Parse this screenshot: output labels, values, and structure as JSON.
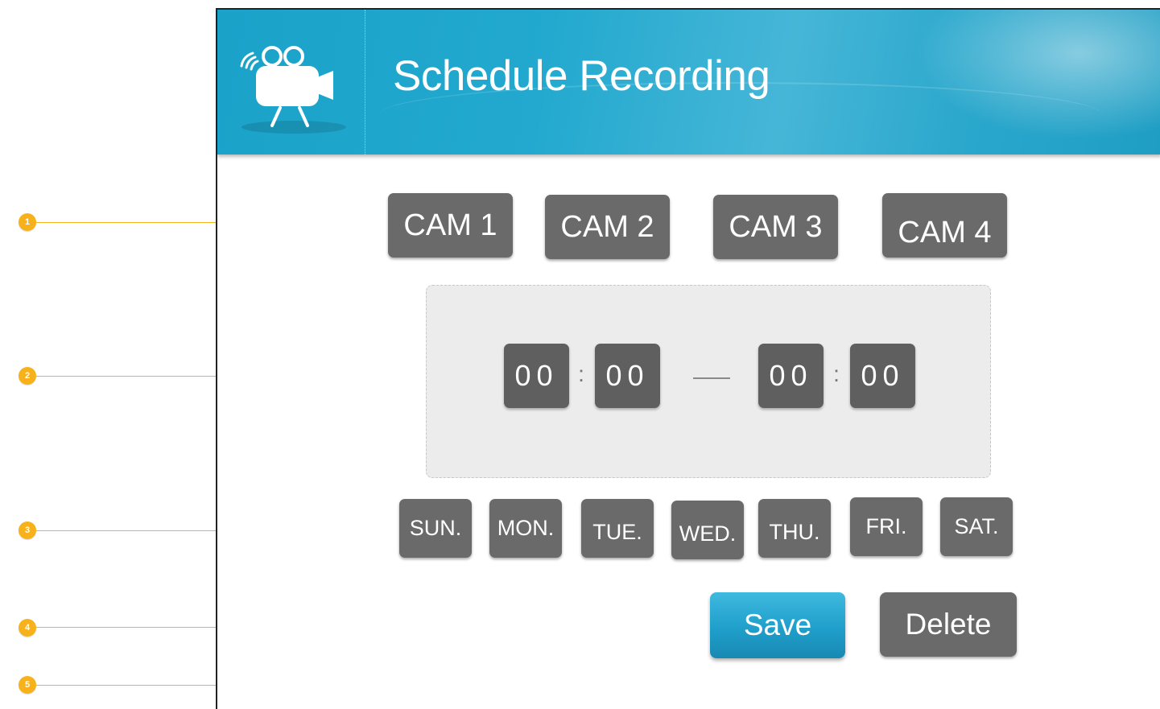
{
  "header": {
    "title": "Schedule Recording",
    "icon": "video-camera-icon"
  },
  "cameras": [
    "CAM 1",
    "CAM 2",
    "CAM 3",
    "CAM 4"
  ],
  "time": {
    "start_hour": "00",
    "start_minute": "00",
    "end_hour": "00",
    "end_minute": "00",
    "separator": ":"
  },
  "days": [
    "SUN.",
    "MON.",
    "TUE.",
    "WED.",
    "THU.",
    "FRI.",
    "SAT."
  ],
  "actions": {
    "save": "Save",
    "delete": "Delete"
  },
  "callouts": [
    "1",
    "2",
    "3",
    "4",
    "5"
  ],
  "colors": {
    "header_blue": "#23a9cf",
    "button_gray": "#6a6a6a",
    "callout_orange": "#f7b21b",
    "save_blue": "#1f9fcb"
  }
}
